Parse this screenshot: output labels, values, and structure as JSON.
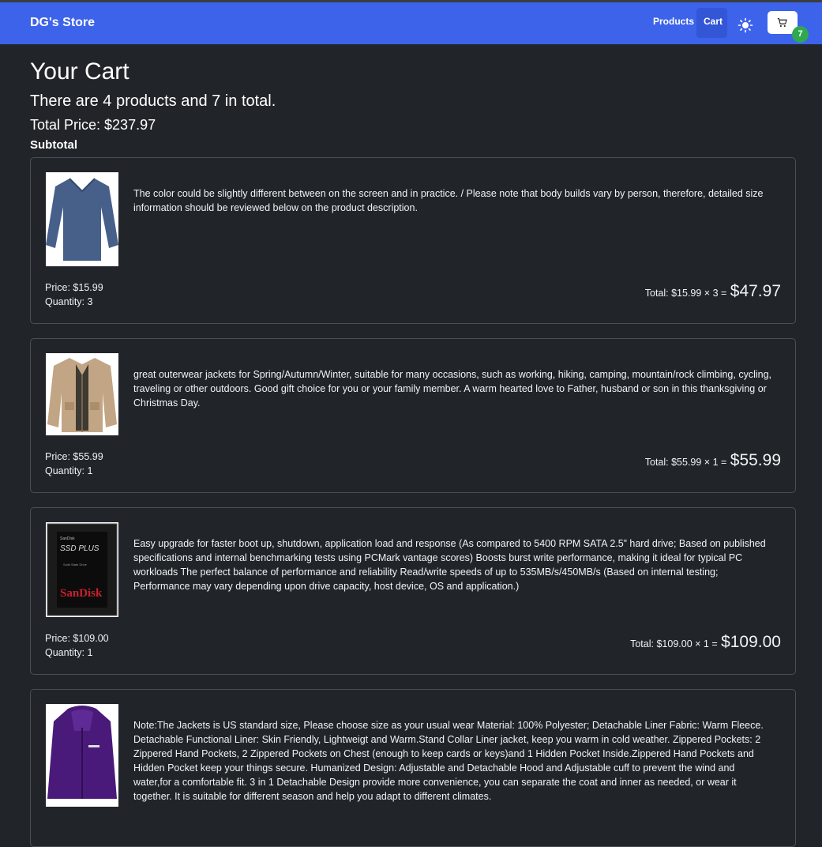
{
  "navbar": {
    "brand": "DG's Store",
    "links": [
      "Products",
      "Cart"
    ],
    "theme_icon": "sun-icon",
    "cart_icon": "cart-icon",
    "cart_badge": "7",
    "accent": "#3d63ea",
    "badge_color": "#2fa84f"
  },
  "page": {
    "title": "Your Cart",
    "summary": "There are 4 products and 7 in total.",
    "total_price": "Total Price: $237.97",
    "subtotal_heading": "Subtotal"
  },
  "items": [
    {
      "image": "blue-shirt-image",
      "description": "The color could be slightly different between on the screen and in practice. / Please note that body builds vary by person, therefore, detailed size information should be reviewed below on the product description.",
      "price": "Price: $15.99",
      "quantity": "Quantity: 3",
      "total_calc": "Total: $15.99 × 3 =",
      "total_value": "$47.97"
    },
    {
      "image": "tan-jacket-image",
      "description": "great outerwear jackets for Spring/Autumn/Winter, suitable for many occasions, such as working, hiking, camping, mountain/rock climbing, cycling, traveling or other outdoors. Good gift choice for you or your family member. A warm hearted love to Father, husband or son in this thanksgiving or Christmas Day.",
      "price": "Price: $55.99",
      "quantity": "Quantity: 1",
      "total_calc": "Total: $55.99 × 1 =",
      "total_value": "$55.99"
    },
    {
      "image": "sandisk-ssd-image",
      "description": "Easy upgrade for faster boot up, shutdown, application load and response (As compared to 5400 RPM SATA 2.5” hard drive; Based on published specifications and internal benchmarking tests using PCMark vantage scores) Boosts burst write performance, making it ideal for typical PC workloads The perfect balance of performance and reliability Read/write speeds of up to 535MB/s/450MB/s (Based on internal testing; Performance may vary depending upon drive capacity, host device, OS and application.)",
      "price": "Price: $109.00",
      "quantity": "Quantity: 1",
      "total_calc": "Total: $109.00 × 1 =",
      "total_value": "$109.00",
      "image_text": [
        "SanDisk",
        "SSD PLUS",
        "Solid State Drive",
        "SanDisk"
      ]
    },
    {
      "image": "purple-jacket-image",
      "description": "Note:The Jackets is US standard size, Please choose size as your usual wear Material: 100% Polyester; Detachable Liner Fabric: Warm Fleece. Detachable Functional Liner: Skin Friendly, Lightweigt and Warm.Stand Collar Liner jacket, keep you warm in cold weather. Zippered Pockets: 2 Zippered Hand Pockets, 2 Zippered Pockets on Chest (enough to keep cards or keys)and 1 Hidden Pocket Inside.Zippered Hand Pockets and Hidden Pocket keep your things secure. Humanized Design: Adjustable and Detachable Hood and Adjustable cuff to prevent the wind and water,for a comfortable fit. 3 in 1 Detachable Design provide more convenience, you can separate the coat and inner as needed, or wear it together. It is suitable for different season and help you adapt to different climates."
    }
  ]
}
